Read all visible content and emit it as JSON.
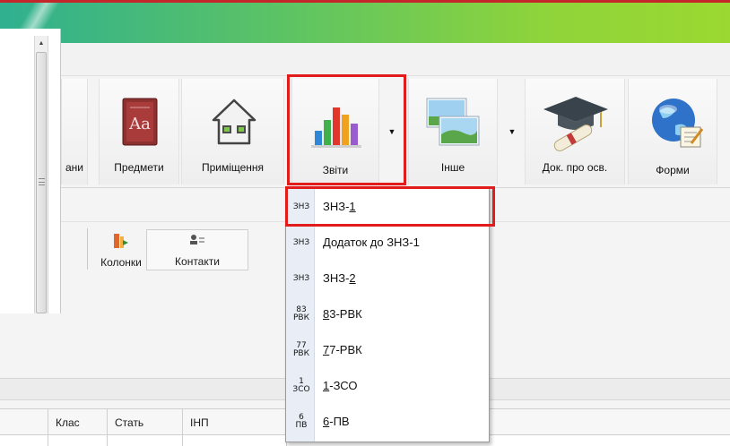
{
  "ribbon": {
    "partial_label": "ани",
    "subjects_label": "Предмети",
    "rooms_label": "Приміщення",
    "reports_label": "Звіти",
    "other_label": "Інше",
    "docs_label": "Док. про осв.",
    "forms_label": "Форми",
    "subjects_book_text": "Aa"
  },
  "toolbar": {
    "columns_label": "Колонки",
    "contacts_label": "Контакти"
  },
  "reports_menu": {
    "items": [
      {
        "icon_top": "ЗНЗ",
        "icon_bottom": "",
        "label_pre": "ЗНЗ-",
        "label_u": "1",
        "label_post": ""
      },
      {
        "icon_top": "ЗНЗ",
        "icon_bottom": "",
        "label_pre": "Додаток до ЗНЗ-1",
        "label_u": "",
        "label_post": ""
      },
      {
        "icon_top": "ЗНЗ",
        "icon_bottom": "",
        "label_pre": "ЗНЗ-",
        "label_u": "2",
        "label_post": ""
      },
      {
        "icon_top": "83",
        "icon_bottom": "РВК",
        "label_pre": "",
        "label_u": "8",
        "label_post": "3-РВК"
      },
      {
        "icon_top": "77",
        "icon_bottom": "РВК",
        "label_pre": "",
        "label_u": "7",
        "label_post": "7-РВК"
      },
      {
        "icon_top": "1",
        "icon_bottom": "ЗСО",
        "label_pre": "",
        "label_u": "1",
        "label_post": "-ЗСО"
      },
      {
        "icon_top": "6",
        "icon_bottom": "ПВ",
        "label_pre": "",
        "label_u": "6",
        "label_post": "-ПВ"
      }
    ]
  },
  "grid": {
    "columns": [
      "Клас",
      "Стать",
      "ІНП"
    ]
  },
  "colors": {
    "highlight": "#e21b1b",
    "banner_start": "#2fb08f",
    "banner_end": "#9bd831"
  }
}
